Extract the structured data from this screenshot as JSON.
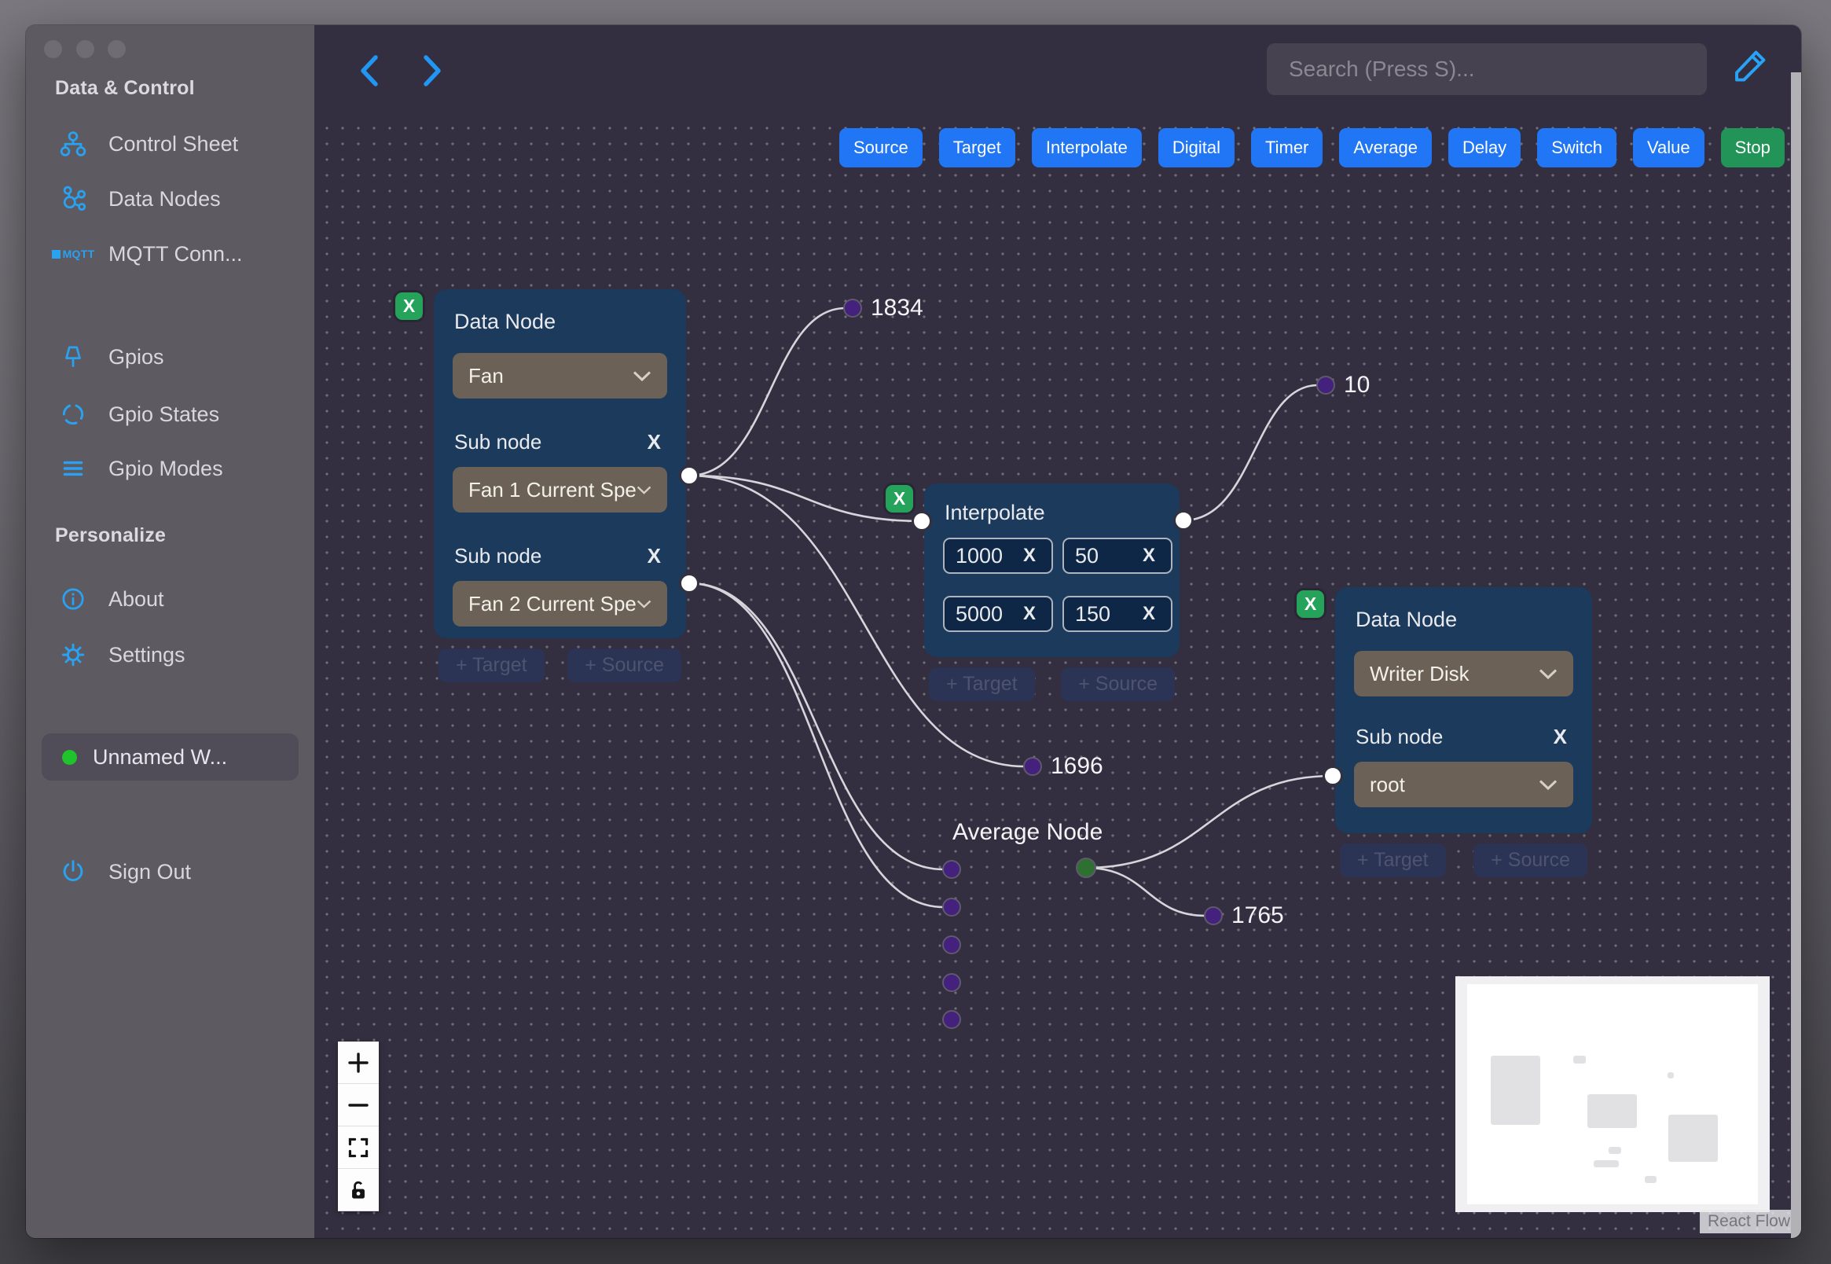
{
  "sidebar": {
    "section_data_control": "Data & Control",
    "items": [
      {
        "label": "Control Sheet"
      },
      {
        "label": "Data Nodes"
      },
      {
        "label": "MQTT Conn..."
      },
      {
        "label": "Gpios"
      },
      {
        "label": "Gpio States"
      },
      {
        "label": "Gpio Modes"
      }
    ],
    "section_personalize": "Personalize",
    "personalize_items": [
      {
        "label": "About"
      },
      {
        "label": "Settings"
      }
    ],
    "workspace": {
      "label": "Unnamed W...",
      "status_color": "#1fc32b"
    },
    "sign_out_label": "Sign Out"
  },
  "navbar": {
    "search_placeholder": "Search (Press S)..."
  },
  "toolbar": {
    "accent_color": "#2176f6",
    "stop_color": "#229457",
    "buttons": [
      {
        "label": "Source"
      },
      {
        "label": "Target"
      },
      {
        "label": "Interpolate"
      },
      {
        "label": "Digital"
      },
      {
        "label": "Timer"
      },
      {
        "label": "Average"
      },
      {
        "label": "Delay"
      },
      {
        "label": "Switch"
      },
      {
        "label": "Value"
      },
      {
        "label": "Stop"
      }
    ]
  },
  "canvas": {
    "fan_node": {
      "title": "Data Node",
      "type_value": "Fan",
      "sub_label_1": "Sub node",
      "sub_value_1": "Fan 1 Current Spe",
      "remove_1": "X",
      "sub_label_2": "Sub node",
      "sub_value_2": "Fan 2 Current Spe",
      "remove_2": "X",
      "delete_label": "X",
      "add_target": "+ Target",
      "add_source": "+ Source"
    },
    "interpolate_node": {
      "title": "Interpolate",
      "delete_label": "X",
      "fields": [
        {
          "value": "1000",
          "remove": "X"
        },
        {
          "value": "50",
          "remove": "X"
        },
        {
          "value": "5000",
          "remove": "X"
        },
        {
          "value": "150",
          "remove": "X"
        }
      ],
      "add_target": "+ Target",
      "add_source": "+ Source"
    },
    "writer_node": {
      "title": "Data Node",
      "type_value": "Writer Disk",
      "sub_label": "Sub node",
      "sub_value": "root",
      "remove": "X",
      "delete_label": "X",
      "add_target": "+ Target",
      "add_source": "+ Source"
    },
    "average_node": {
      "title": "Average Node"
    },
    "edge_labels": {
      "l1834": "1834",
      "l10": "10",
      "l1696": "1696",
      "l1765": "1765"
    },
    "badge_color": "#26a35b",
    "node_color": "#1b3a5c",
    "edge_color": "#d5d5db",
    "purple_dot_color": "#44217c",
    "green_dot_color": "#2d7032"
  },
  "minimap": {
    "attribution": "React Flow"
  }
}
